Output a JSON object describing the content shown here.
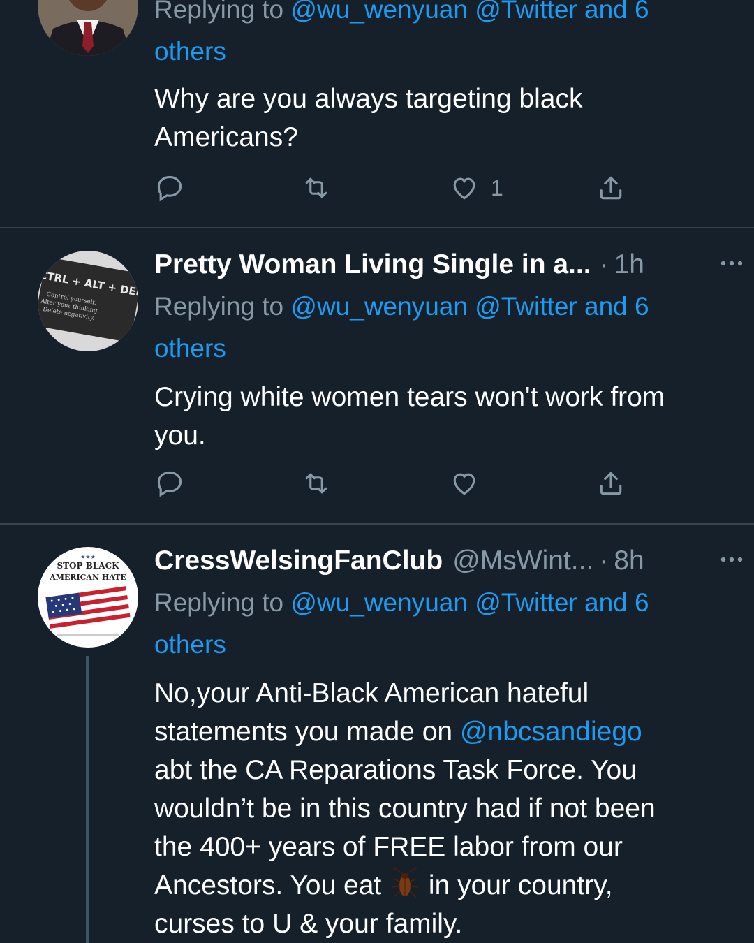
{
  "tweets": [
    {
      "avatar_icon": "man-in-suit-avatar",
      "reply_label": "Replying to",
      "reply_mentions": "@wu_wenyuan @Twitter and 6 others",
      "text": "Why are you always targeting black Americans?",
      "like_count": "1"
    },
    {
      "avatar_icon": "ctrl-alt-del-avatar",
      "avatar_text": {
        "line1": "CTRL + ALT + DEL",
        "line2": "Control yourself.",
        "line3": "Alter your thinking.",
        "line4": "Delete negativity."
      },
      "name": "Pretty Woman Living Single in a...",
      "dot": "·",
      "time": "1h",
      "reply_label": "Replying to",
      "reply_mentions_line1": "@wu_wenyuan @Twitter and 6",
      "reply_mentions_line2": "others",
      "text_line1": "Crying white women tears won't work from",
      "text_line2": "you."
    },
    {
      "avatar_icon": "stop-black-american-hate-flag-avatar",
      "avatar_text": {
        "line1": "STOP BLACK",
        "line2": "AMERICAN HATE"
      },
      "name": "CressWelsingFanClub",
      "handle": "@MsWint...",
      "dot": "·",
      "time": "8h",
      "reply_label": "Replying to",
      "reply_mentions_line1": "@wu_wenyuan @Twitter and 6",
      "reply_mentions_line2": "others",
      "text_lines": {
        "l1": "No,your Anti-Black American hateful",
        "l2_before": "statements you made on ",
        "l2_mention": "@nbcsandiego",
        "l3": "abt the CA Reparations Task Force. You",
        "l4": "wouldn’t be in this country had if not been",
        "l5": "the 400+ years of FREE labor from our",
        "l6_before": "Ancestors. You eat ",
        "l6_emoji": "cockroach-emoji",
        "l6_after": " in your country,",
        "l7": "curses to U & your family."
      }
    }
  ],
  "colors": {
    "background": "#15202b",
    "text": "#ffffff",
    "secondary": "#8899a6",
    "link": "#1d9bf0",
    "divider": "#38444d"
  }
}
